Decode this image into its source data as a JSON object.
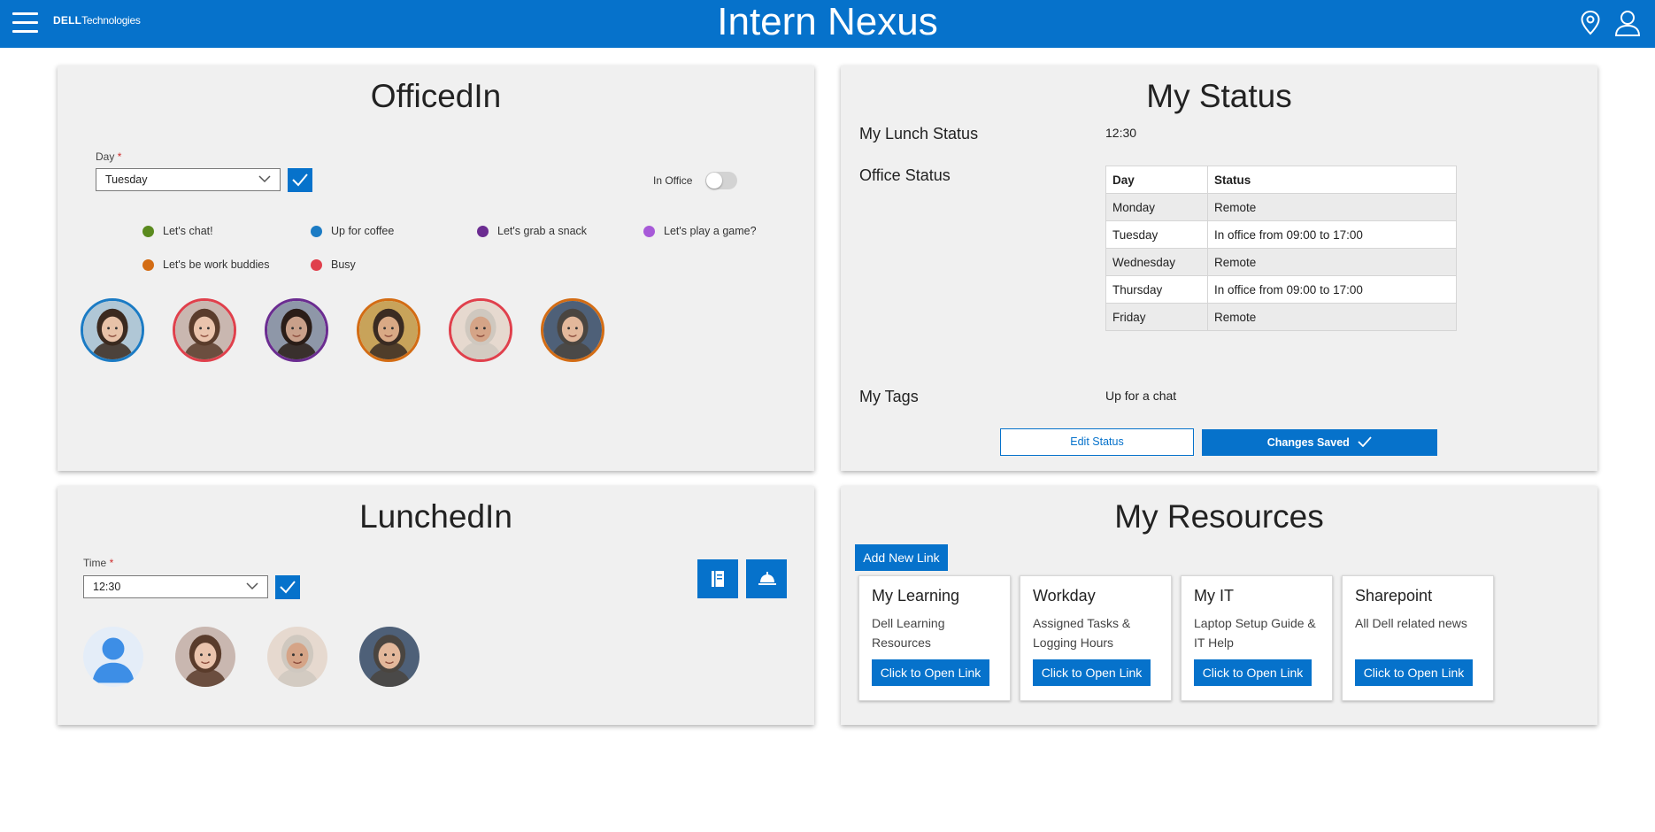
{
  "header": {
    "brand_bold": "DELL",
    "brand_rest": "Technologies",
    "title": "Intern Nexus",
    "icons": [
      "menu-icon",
      "location-pin-icon",
      "user-icon"
    ]
  },
  "officedin": {
    "title": "OfficedIn",
    "day_label": "Day",
    "required_mark": "*",
    "day_value": "Tuesday",
    "toggle_label": "In Office",
    "toggle_on": false,
    "legend": [
      {
        "label": "Let's chat!",
        "color": "#5a8a1e"
      },
      {
        "label": "Up for coffee",
        "color": "#1b7bc4"
      },
      {
        "label": "Let's grab a snack",
        "color": "#6b2c91"
      },
      {
        "label": "Let's play a game?",
        "color": "#a75ad8"
      },
      {
        "label": "Let's be work buddies",
        "color": "#d36c14"
      },
      {
        "label": "Busy",
        "color": "#e0404c"
      }
    ],
    "people": [
      {
        "ring": "#1b7bc4",
        "skin": "#e8c2a8",
        "hair": "#3b2a20",
        "bg": "#b0c7d6"
      },
      {
        "ring": "#e0404c",
        "skin": "#eac4ad",
        "hair": "#5a3c2c",
        "bg": "#c9b7b0"
      },
      {
        "ring": "#6b2c91",
        "skin": "#c9a08a",
        "hair": "#2a1d18",
        "bg": "#8e97a8"
      },
      {
        "ring": "#d36c14",
        "skin": "#d9a985",
        "hair": "#3a2b22",
        "bg": "#c8a35a"
      },
      {
        "ring": "#e0404c",
        "skin": "#d5a487",
        "hair": "#cfc8bf",
        "bg": "#e6d9cf"
      },
      {
        "ring": "#d36c14",
        "skin": "#e3b89b",
        "hair": "#4a4540",
        "bg": "#4e6078"
      }
    ]
  },
  "status": {
    "title": "My Status",
    "lunch_label": "My Lunch Status",
    "lunch_value": "12:30",
    "office_label": "Office Status",
    "table_headers": [
      "Day",
      "Status"
    ],
    "rows": [
      [
        "Monday",
        "Remote"
      ],
      [
        "Tuesday",
        "In office from 09:00 to 17:00"
      ],
      [
        "Wednesday",
        "Remote"
      ],
      [
        "Thursday",
        "In office from 09:00 to 17:00"
      ],
      [
        "Friday",
        "Remote"
      ]
    ],
    "tags_label": "My Tags",
    "tags_value": "Up for a chat",
    "edit_button": "Edit Status",
    "saved_button": "Changes Saved"
  },
  "lunchedin": {
    "title": "LunchedIn",
    "time_label": "Time",
    "required_mark": "*",
    "time_value": "12:30",
    "people": [
      {
        "type": "placeholder"
      },
      {
        "type": "photo",
        "skin": "#eac4ad",
        "hair": "#5a3c2c",
        "bg": "#c9b7b0"
      },
      {
        "type": "photo",
        "skin": "#d5a487",
        "hair": "#cfc8bf",
        "bg": "#e6d9cf"
      },
      {
        "type": "photo",
        "skin": "#e3b89b",
        "hair": "#4a4540",
        "bg": "#4e6078"
      }
    ]
  },
  "resources": {
    "title": "My Resources",
    "add_button": "Add New Link",
    "cards": [
      {
        "title": "My Learning",
        "desc": "Dell Learning Resources",
        "button": "Click to Open Link"
      },
      {
        "title": "Workday",
        "desc": "Assigned Tasks & Logging Hours",
        "button": "Click to Open Link"
      },
      {
        "title": "My IT",
        "desc": "Laptop Setup Guide & IT Help",
        "button": "Click to Open Link"
      },
      {
        "title": "Sharepoint",
        "desc": "All Dell related news",
        "button": "Click to Open Link"
      }
    ]
  },
  "colors": {
    "accent": "#0672cb",
    "card_bg": "#f0f0f0"
  }
}
